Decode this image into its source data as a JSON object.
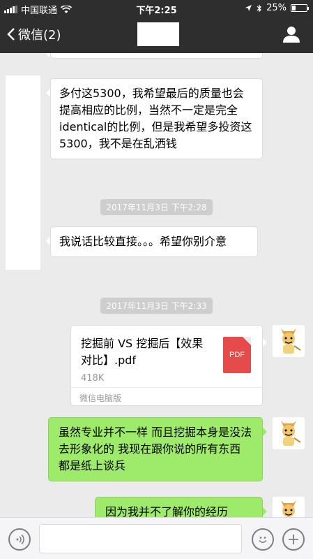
{
  "status_bar": {
    "carrier": "中国联通",
    "time": "下午2:25",
    "battery": "25%"
  },
  "nav": {
    "back_label": "微信(2)"
  },
  "messages": [
    {
      "text": "多付这5300，我希望最后的质量也会提高相应的比例，当然不一定是完全identical的比例，但是我希望多投资这5300，我不是在乱洒钱"
    },
    {
      "text": "我说话比较直接。。。希望你别介意"
    },
    {
      "text": "虽然专业并不一样 而且挖掘本身是没法去形象化的 我现在跟你说的所有东西 都是纸上谈兵"
    },
    {
      "text": "因为我并不了解你的经历"
    }
  ],
  "timestamps": [
    "2017年11月3日 下午2:28",
    "2017年11月3日 下午2:33"
  ],
  "file": {
    "name": "挖掘前 VS 挖掘后【效果对比】.pdf",
    "size": "418K",
    "source": "微信电脑版",
    "badge": "PDF"
  },
  "input": {
    "placeholder": ""
  },
  "colors": {
    "nav_bg": "#2e2e2e",
    "sent_bubble": "#9eea6a",
    "chat_bg": "#ebebeb",
    "pdf_red": "#e54b4b"
  }
}
